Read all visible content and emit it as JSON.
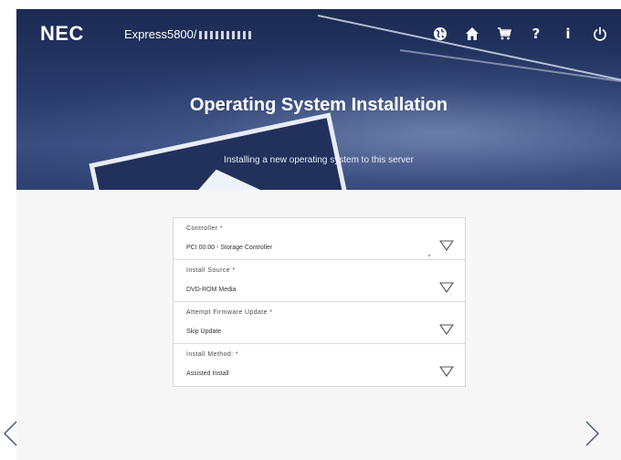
{
  "header": {
    "logo": "NEC",
    "model": "Express5800/",
    "nav": [
      {
        "icon": "globe-icon"
      },
      {
        "icon": "home-icon"
      },
      {
        "icon": "cart-icon"
      },
      {
        "icon": "help-icon",
        "glyph": "?"
      },
      {
        "icon": "info-icon",
        "glyph": "i"
      },
      {
        "icon": "power-icon"
      }
    ]
  },
  "banner": {
    "title": "Operating System Installation",
    "subtitle": "Installing a new operating system to this server"
  },
  "form": {
    "fields": [
      {
        "label": "Controller *",
        "value": "PCI 00:00 - Storage Controller"
      },
      {
        "label": "Install Source *",
        "value": "DVD-ROM Media"
      },
      {
        "label": "Attempt Firmware Update *",
        "value": "Skip Update"
      },
      {
        "label": "Install Method: *",
        "value": "Assisted Install"
      }
    ]
  },
  "colors": {
    "banner": "#283a6b",
    "page_background": "#f7f7f7",
    "field_border": "#dadada",
    "arrow": "#3b4f86"
  }
}
